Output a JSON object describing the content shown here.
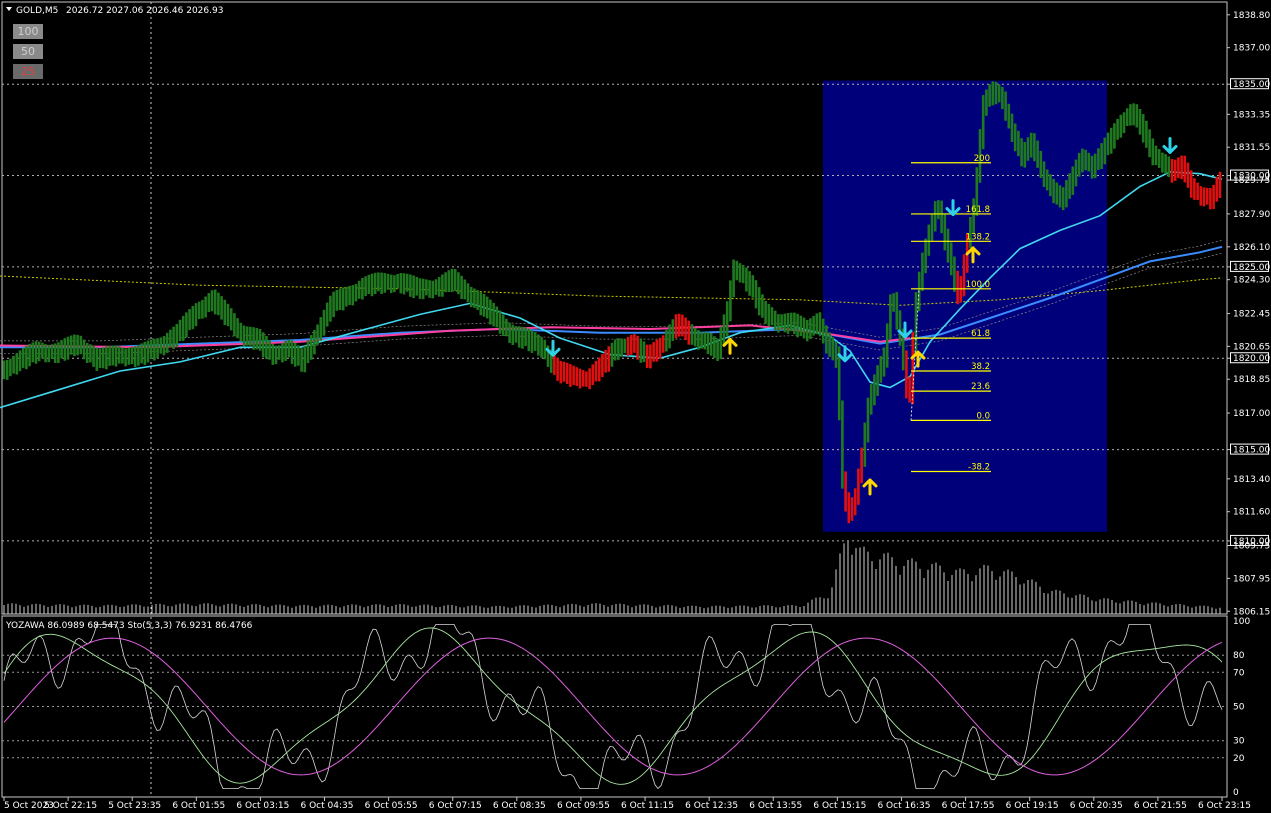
{
  "header": {
    "symbol": "GOLD,M5",
    "ohlc": "2026.72 2027.06 2026.46 2026.93"
  },
  "period_buttons": [
    {
      "label": "100",
      "selected": false
    },
    {
      "label": "50",
      "selected": false
    },
    {
      "label": "25",
      "selected": true
    }
  ],
  "colors": {
    "background": "#000000",
    "bull_bar": "#1f7a1f",
    "bear_bar": "#e01010",
    "fib_box": "#00007a",
    "fib_line": "#ffff00",
    "ma_fast": "#40d8f0",
    "ma_slow": "#3a8cff",
    "ma_magenta": "#ff40a0",
    "ma_yellow_dotted": "#cccc00",
    "buy_arrow": "#ffd700",
    "sell_arrow": "#30d0e8",
    "osc_white": "#d8d8d8",
    "osc_green": "#a8e8a0",
    "osc_pink": "#e060e0"
  },
  "chart_data": {
    "type": "line",
    "title": "GOLD,M5",
    "price_axis": {
      "labels": [
        "1838.80",
        "1837.00",
        "1835.00",
        "1833.35",
        "1831.55",
        "1830.00",
        "1829.75",
        "1827.90",
        "1826.10",
        "1825.00",
        "1824.30",
        "1822.45",
        "1820.65",
        "1820.00",
        "1818.85",
        "1817.00",
        "1815.00",
        "1813.40",
        "1811.60",
        "1810.00",
        "1809.75",
        "1807.95",
        "1806.15"
      ],
      "ylim": [
        1806.0,
        1839.5
      ],
      "highlighted": [
        "1835.00",
        "1830.00",
        "1825.00",
        "1820.00",
        "1815.00",
        "1810.00"
      ],
      "current_price": "1830.00"
    },
    "time_axis": [
      "5 Oct 2023",
      "5 Oct 22:15",
      "5 Oct 23:35",
      "6 Oct 01:55",
      "6 Oct 03:15",
      "6 Oct 04:35",
      "6 Oct 05:55",
      "6 Oct 07:15",
      "6 Oct 08:35",
      "6 Oct 09:55",
      "6 Oct 11:15",
      "6 Oct 12:35",
      "6 Oct 13:55",
      "6 Oct 15:15",
      "6 Oct 16:35",
      "6 Oct 17:55",
      "6 Oct 19:15",
      "6 Oct 20:35",
      "6 Oct 21:55",
      "6 Oct 23:15"
    ],
    "fib_levels": [
      {
        "label": "200",
        "price": 1830.7
      },
      {
        "label": "161.8",
        "price": 1827.9
      },
      {
        "label": "138.2",
        "price": 1826.4
      },
      {
        "label": "100.0",
        "price": 1823.8
      },
      {
        "label": "61.8",
        "price": 1821.1
      },
      {
        "label": "38.2",
        "price": 1819.3
      },
      {
        "label": "23.6",
        "price": 1818.2
      },
      {
        "label": "0.0",
        "price": 1816.6
      },
      {
        "label": "-38.2",
        "price": 1813.8
      }
    ],
    "price_series": [
      [
        0,
        1819.2
      ],
      [
        20,
        1819.8
      ],
      [
        40,
        1820.4
      ],
      [
        60,
        1820.3
      ],
      [
        80,
        1820.8
      ],
      [
        100,
        1819.9
      ],
      [
        120,
        1820.2
      ],
      [
        140,
        1820.1
      ],
      [
        160,
        1820.6
      ],
      [
        180,
        1821.3
      ],
      [
        200,
        1822.6
      ],
      [
        215,
        1823.2
      ],
      [
        230,
        1822.3
      ],
      [
        245,
        1821.3
      ],
      [
        260,
        1821.0
      ],
      [
        275,
        1820.2
      ],
      [
        290,
        1820.5
      ],
      [
        305,
        1819.8
      ],
      [
        320,
        1821.4
      ],
      [
        335,
        1823.0
      ],
      [
        350,
        1823.4
      ],
      [
        365,
        1823.9
      ],
      [
        380,
        1824.1
      ],
      [
        400,
        1824.2
      ],
      [
        420,
        1823.8
      ],
      [
        440,
        1823.9
      ],
      [
        455,
        1824.3
      ],
      [
        470,
        1823.6
      ],
      [
        485,
        1822.9
      ],
      [
        500,
        1822.1
      ],
      [
        515,
        1821.3
      ],
      [
        530,
        1821.0
      ],
      [
        545,
        1820.6
      ],
      [
        560,
        1819.3
      ],
      [
        575,
        1819.0
      ],
      [
        590,
        1818.9
      ],
      [
        605,
        1819.6
      ],
      [
        620,
        1820.6
      ],
      [
        635,
        1820.8
      ],
      [
        650,
        1820.0
      ],
      [
        665,
        1820.8
      ],
      [
        680,
        1821.9
      ],
      [
        695,
        1821.2
      ],
      [
        710,
        1820.9
      ],
      [
        720,
        1820.3
      ],
      [
        730,
        1822.4
      ],
      [
        737,
        1825.0
      ],
      [
        745,
        1824.6
      ],
      [
        755,
        1823.8
      ],
      [
        765,
        1822.6
      ],
      [
        780,
        1822.0
      ],
      [
        795,
        1821.9
      ],
      [
        810,
        1821.5
      ],
      [
        820,
        1822.1
      ],
      [
        830,
        1820.8
      ],
      [
        840,
        1820.0
      ],
      [
        846,
        1812.8
      ],
      [
        852,
        1811.5
      ],
      [
        858,
        1812.4
      ],
      [
        864,
        1814.3
      ],
      [
        872,
        1817.6
      ],
      [
        880,
        1818.9
      ],
      [
        888,
        1820.2
      ],
      [
        895,
        1823.8
      ],
      [
        905,
        1820.5
      ],
      [
        912,
        1817.3
      ],
      [
        918,
        1822.6
      ],
      [
        925,
        1825.1
      ],
      [
        932,
        1826.9
      ],
      [
        940,
        1828.5
      ],
      [
        948,
        1826.5
      ],
      [
        956,
        1824.6
      ],
      [
        962,
        1823.2
      ],
      [
        970,
        1826.3
      ],
      [
        978,
        1828.7
      ],
      [
        986,
        1833.8
      ],
      [
        995,
        1834.6
      ],
      [
        1005,
        1834.3
      ],
      [
        1015,
        1832.4
      ],
      [
        1025,
        1831.0
      ],
      [
        1035,
        1831.8
      ],
      [
        1045,
        1830.2
      ],
      [
        1055,
        1829.2
      ],
      [
        1065,
        1828.6
      ],
      [
        1075,
        1829.8
      ],
      [
        1085,
        1831.1
      ],
      [
        1095,
        1830.4
      ],
      [
        1105,
        1831.2
      ],
      [
        1115,
        1832.1
      ],
      [
        1125,
        1833.0
      ],
      [
        1135,
        1833.5
      ],
      [
        1145,
        1832.6
      ],
      [
        1155,
        1831.2
      ],
      [
        1165,
        1830.8
      ],
      [
        1175,
        1830.2
      ],
      [
        1185,
        1830.5
      ],
      [
        1195,
        1829.3
      ],
      [
        1205,
        1828.9
      ],
      [
        1215,
        1828.7
      ],
      [
        1222,
        1829.6
      ]
    ],
    "ma_fast_cyan": [
      [
        0,
        1817.3
      ],
      [
        60,
        1818.3
      ],
      [
        120,
        1819.3
      ],
      [
        180,
        1819.8
      ],
      [
        240,
        1820.6
      ],
      [
        300,
        1820.6
      ],
      [
        360,
        1821.5
      ],
      [
        420,
        1822.4
      ],
      [
        470,
        1823.0
      ],
      [
        520,
        1822.2
      ],
      [
        560,
        1821.1
      ],
      [
        610,
        1820.2
      ],
      [
        660,
        1820.0
      ],
      [
        700,
        1820.6
      ],
      [
        740,
        1821.4
      ],
      [
        790,
        1821.8
      ],
      [
        830,
        1821.2
      ],
      [
        850,
        1820.4
      ],
      [
        870,
        1818.7
      ],
      [
        890,
        1818.4
      ],
      [
        910,
        1819.0
      ],
      [
        930,
        1820.9
      ],
      [
        960,
        1822.7
      ],
      [
        990,
        1824.4
      ],
      [
        1020,
        1826.0
      ],
      [
        1060,
        1827.0
      ],
      [
        1100,
        1827.8
      ],
      [
        1140,
        1829.4
      ],
      [
        1170,
        1830.2
      ],
      [
        1200,
        1830.1
      ],
      [
        1222,
        1829.8
      ]
    ],
    "ma_slow_blue": [
      [
        0,
        1820.6
      ],
      [
        100,
        1820.6
      ],
      [
        200,
        1820.8
      ],
      [
        300,
        1821.0
      ],
      [
        400,
        1821.4
      ],
      [
        500,
        1821.6
      ],
      [
        600,
        1821.4
      ],
      [
        700,
        1821.4
      ],
      [
        800,
        1821.6
      ],
      [
        880,
        1820.8
      ],
      [
        940,
        1821.3
      ],
      [
        990,
        1822.2
      ],
      [
        1050,
        1823.3
      ],
      [
        1100,
        1824.3
      ],
      [
        1150,
        1825.3
      ],
      [
        1200,
        1825.8
      ],
      [
        1222,
        1826.1
      ]
    ],
    "ma_magenta": [
      [
        0,
        1820.7
      ],
      [
        150,
        1820.6
      ],
      [
        300,
        1820.9
      ],
      [
        450,
        1821.5
      ],
      [
        550,
        1821.7
      ],
      [
        650,
        1821.6
      ],
      [
        750,
        1821.8
      ],
      [
        820,
        1821.4
      ],
      [
        880,
        1820.9
      ],
      [
        910,
        1821.1
      ]
    ],
    "ma_yellow_dotted": [
      [
        0,
        1824.5
      ],
      [
        200,
        1824.0
      ],
      [
        400,
        1823.8
      ],
      [
        600,
        1823.4
      ],
      [
        800,
        1823.2
      ],
      [
        900,
        1822.9
      ],
      [
        1000,
        1823.2
      ],
      [
        1100,
        1823.7
      ],
      [
        1200,
        1824.3
      ],
      [
        1222,
        1824.4
      ]
    ],
    "signals": [
      {
        "type": "sell",
        "x": 553,
        "price": 1820.6
      },
      {
        "type": "buy",
        "x": 730,
        "price": 1820.6
      },
      {
        "type": "sell",
        "x": 845,
        "price": 1820.3
      },
      {
        "type": "buy",
        "x": 870,
        "price": 1812.9
      },
      {
        "type": "sell",
        "x": 905,
        "price": 1821.6
      },
      {
        "type": "buy",
        "x": 918,
        "price": 1819.9
      },
      {
        "type": "sell",
        "x": 953,
        "price": 1828.3
      },
      {
        "type": "buy",
        "x": 973,
        "price": 1825.6
      },
      {
        "type": "sell",
        "x": 1170,
        "price": 1831.7
      }
    ],
    "volume": [
      [
        0,
        0.12
      ],
      [
        100,
        0.1
      ],
      [
        200,
        0.12
      ],
      [
        300,
        0.1
      ],
      [
        400,
        0.11
      ],
      [
        500,
        0.09
      ],
      [
        600,
        0.12
      ],
      [
        700,
        0.09
      ],
      [
        800,
        0.1
      ],
      [
        830,
        0.25
      ],
      [
        848,
        1.0
      ],
      [
        860,
        0.75
      ],
      [
        880,
        0.7
      ],
      [
        900,
        0.63
      ],
      [
        930,
        0.58
      ],
      [
        960,
        0.5
      ],
      [
        990,
        0.55
      ],
      [
        1020,
        0.45
      ],
      [
        1050,
        0.28
      ],
      [
        1100,
        0.18
      ],
      [
        1150,
        0.13
      ],
      [
        1222,
        0.08
      ]
    ],
    "oscillator": {
      "label": "YOZAWA 86.0989 68.5473  Sto(5,3,3) 76.9231 86.4766",
      "levels": [
        "100",
        "80",
        "70",
        "50",
        "30",
        "20",
        "0"
      ]
    }
  }
}
